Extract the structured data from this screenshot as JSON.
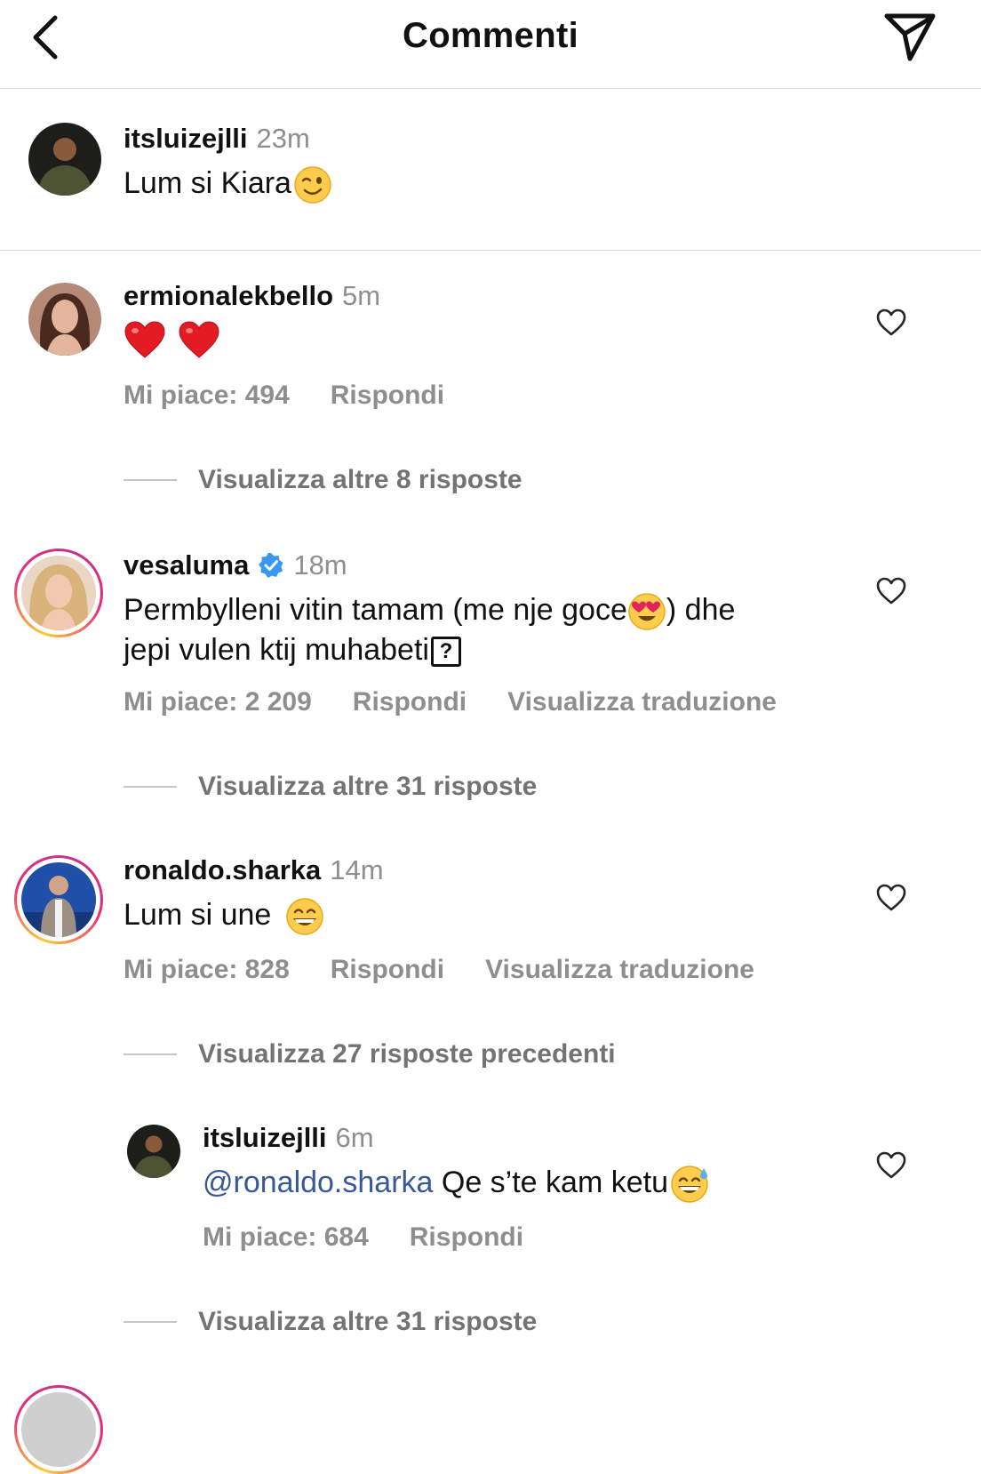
{
  "header": {
    "title": "Commenti"
  },
  "caption": {
    "username": "itsluizejlli",
    "time": "23m",
    "text": "Lum si Kiara"
  },
  "comments": [
    {
      "username": "ermionalekbello",
      "time": "5m",
      "text": "",
      "likes": "Mi piace: 494",
      "reply": "Rispondi",
      "view_more": "Visualizza altre 8 risposte"
    },
    {
      "username": "vesaluma",
      "verified": true,
      "time": "18m",
      "text_line1_a": "Permbylleni vitin tamam (me nje goce",
      "text_line1_b": ") dhe",
      "text_line2": "jepi vulen ktij muhabeti",
      "likes": "Mi piace: 2 209",
      "reply": "Rispondi",
      "translate": "Visualizza traduzione",
      "view_more": "Visualizza altre 31 risposte"
    },
    {
      "username": "ronaldo.sharka",
      "time": "14m",
      "text": "Lum si une",
      "likes": "Mi piace: 828",
      "reply": "Rispondi",
      "translate": "Visualizza traduzione",
      "view_previous": "Visualizza 27 risposte precedenti",
      "reply_item": {
        "username": "itsluizejlli",
        "time": "6m",
        "mention": "@ronaldo.sharka",
        "text": " Qe s’te kam ketu",
        "likes": "Mi piace: 684",
        "reply": "Rispondi"
      },
      "view_more": "Visualizza altre 31 risposte"
    }
  ],
  "icons": {
    "back": "chevron-left-icon",
    "send": "send-icon",
    "like": "heart-outline-icon",
    "verified": "verified-badge-icon"
  },
  "colors": {
    "text": "#111111",
    "muted": "#8e8e8e",
    "divider": "#dcdcdc",
    "mention": "#385898",
    "verified": "#3897f0"
  }
}
